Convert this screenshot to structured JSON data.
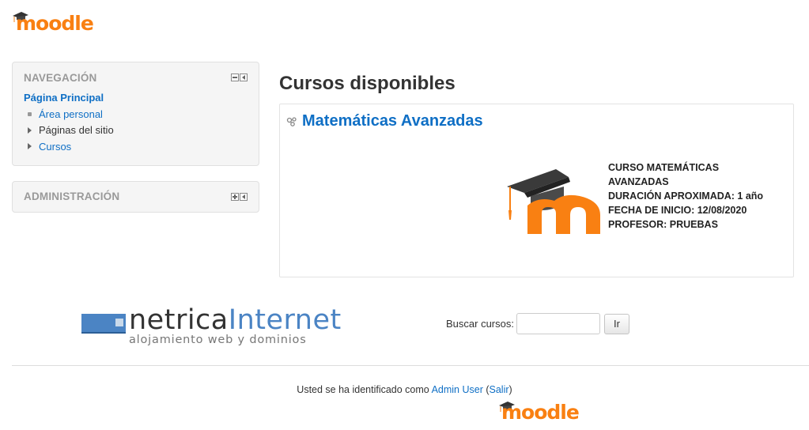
{
  "brand": {
    "name": "moodle",
    "color": "#f98012",
    "icon": "graduation-cap-icon"
  },
  "navigation": {
    "title": "NAVEGACIÓN",
    "home": "Página Principal",
    "items": [
      {
        "label": "Área personal",
        "type": "link",
        "icon": "bullet-icon"
      },
      {
        "label": "Páginas del sitio",
        "type": "text",
        "icon": "expand-triangle-icon"
      },
      {
        "label": "Cursos",
        "type": "link",
        "icon": "expand-triangle-icon"
      }
    ]
  },
  "administration": {
    "title": "ADMINISTRACIÓN"
  },
  "main": {
    "heading": "Cursos disponibles",
    "course": {
      "title": "Matemáticas Avanzadas",
      "summary": [
        "CURSO MATEMÁTICAS",
        "AVANZADAS",
        "DURACIÓN APROXIMADA: 1 año",
        "FECHA DE INICIO: 12/08/2020",
        "PROFESOR: PRUEBAS"
      ]
    }
  },
  "sponsor": {
    "word_dark": "netrica",
    "word_blue": "Internet",
    "tagline": "alojamiento web y dominios"
  },
  "search": {
    "label": "Buscar cursos:",
    "value": "",
    "button": "Ir"
  },
  "footer": {
    "login_prefix": "Usted se ha identificado como",
    "user": "Admin User",
    "logout": "Salir"
  },
  "colors": {
    "link": "#0f6fc5",
    "accent": "#f98012",
    "netrica_blue": "#4b84c4"
  }
}
